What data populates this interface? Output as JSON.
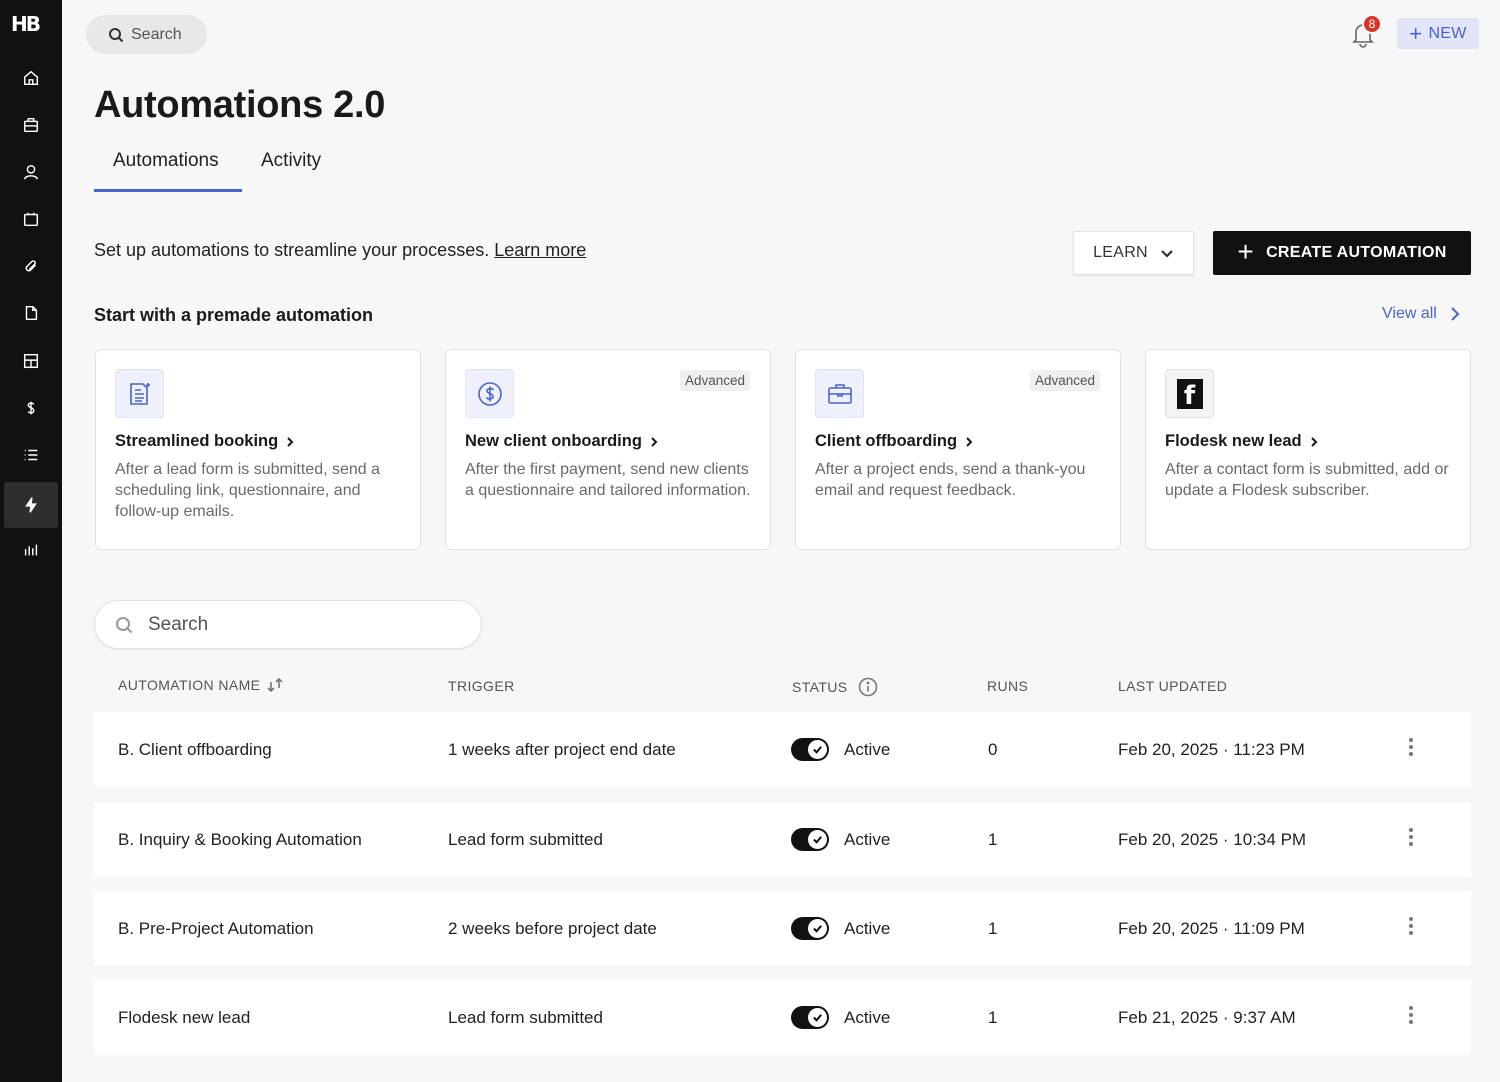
{
  "app": {
    "logo": "HB"
  },
  "sidebar": {
    "items": [
      {
        "icon": "home-icon"
      },
      {
        "icon": "briefcase-icon"
      },
      {
        "icon": "user-icon"
      },
      {
        "icon": "calendar-icon"
      },
      {
        "icon": "paperclip-icon"
      },
      {
        "icon": "document-icon"
      },
      {
        "icon": "layout-icon"
      },
      {
        "icon": "dollar-icon"
      },
      {
        "icon": "list-icon"
      },
      {
        "icon": "lightning-icon",
        "active": true
      },
      {
        "icon": "bar-chart-icon"
      }
    ]
  },
  "topbar": {
    "search_placeholder": "Search",
    "notification_count": "8",
    "new_label": "NEW",
    "new_icon": "+"
  },
  "page": {
    "title": "Automations 2.0",
    "tabs": [
      {
        "label": "Automations",
        "active": true
      },
      {
        "label": "Activity",
        "active": false
      }
    ],
    "intro_text": "Set up automations to streamline your processes.",
    "learn_more": "Learn more",
    "learn_label": "LEARN",
    "create_label": "CREATE AUTOMATION",
    "create_icon": "+"
  },
  "premade": {
    "title": "Start with a premade automation",
    "view_all": "View all",
    "cards": [
      {
        "icon": "form-icon",
        "badge": "",
        "title": "Streamlined booking",
        "desc": "After a lead form is submitted, send a scheduling link, questionnaire, and follow-up emails."
      },
      {
        "icon": "dollar-circle-icon",
        "badge": "Advanced",
        "title": "New client onboarding",
        "desc": "After the first payment, send new clients a questionnaire and tailored information."
      },
      {
        "icon": "briefcase-icon",
        "badge": "Advanced",
        "title": "Client offboarding",
        "desc": "After a project ends, send a thank-you email and request feedback."
      },
      {
        "icon": "flodesk-icon",
        "badge": "",
        "title": "Flodesk new lead",
        "desc": "After a contact form is submitted, add or update a Flodesk subscriber.",
        "logo_letter": "f"
      }
    ]
  },
  "table": {
    "search_placeholder": "Search",
    "headers": {
      "name": "AUTOMATION NAME",
      "trigger": "TRIGGER",
      "status": "STATUS",
      "runs": "RUNS",
      "updated": "LAST UPDATED"
    },
    "rows": [
      {
        "name": "B. Client offboarding",
        "trigger": "1 weeks after project end date",
        "status": "Active",
        "enabled": true,
        "runs": "0",
        "updated": "Feb 20, 2025 · 11:23 PM"
      },
      {
        "name": "B. Inquiry & Booking Automation",
        "trigger": "Lead form submitted",
        "status": "Active",
        "enabled": true,
        "runs": "1",
        "updated": "Feb 20, 2025 · 10:34 PM"
      },
      {
        "name": "B. Pre-Project Automation",
        "trigger": "2 weeks before project date",
        "status": "Active",
        "enabled": true,
        "runs": "1",
        "updated": "Feb 20, 2025 · 11:09 PM"
      },
      {
        "name": "Flodesk new lead",
        "trigger": "Lead form submitted",
        "status": "Active",
        "enabled": true,
        "runs": "1",
        "updated": "Feb 21, 2025 · 9:37 AM"
      }
    ]
  },
  "colors": {
    "accent": "#4b63cc",
    "sidebar": "#111111",
    "background": "#f7f7f7",
    "badge_red": "#d9342b"
  }
}
